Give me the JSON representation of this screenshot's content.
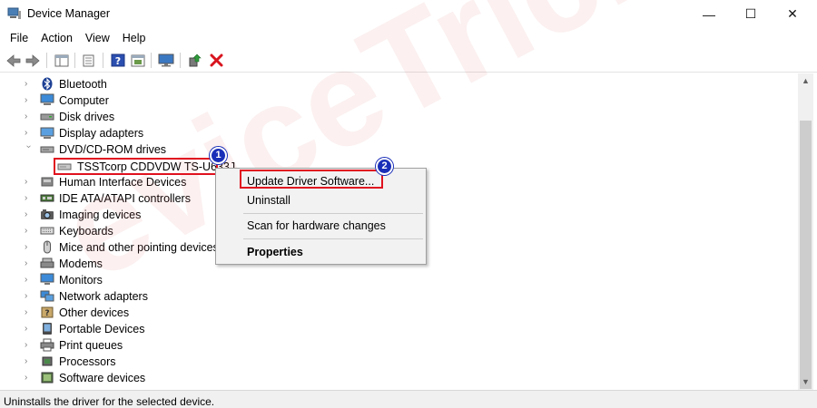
{
  "window": {
    "title": "Device Manager",
    "minimize_glyph": "—",
    "maximize_glyph": "☐",
    "close_glyph": "✕"
  },
  "menu": [
    "File",
    "Action",
    "View",
    "Help"
  ],
  "toolbar": {
    "icons": [
      "back-arrow-icon",
      "forward-arrow-icon",
      "show-hide-console-tree-icon",
      "properties-icon",
      "help-icon",
      "action-pane-icon",
      "monitor-icon",
      "update-driver-icon",
      "uninstall-x-icon"
    ],
    "uninstall_color": "#d8141e"
  },
  "tree": {
    "items": [
      {
        "label": "Bluetooth",
        "icon": "bluetooth-icon",
        "expanded": false
      },
      {
        "label": "Computer",
        "icon": "computer-icon",
        "expanded": false
      },
      {
        "label": "Disk drives",
        "icon": "disk-drive-icon",
        "expanded": false
      },
      {
        "label": "Display adapters",
        "icon": "display-adapter-icon",
        "expanded": false
      },
      {
        "label": "DVD/CD-ROM drives",
        "icon": "dvd-drive-icon",
        "expanded": true
      },
      {
        "label": "TSSTcorp CDDVDW TS-U633J",
        "icon": "dvd-drive-icon",
        "child": true
      },
      {
        "label": "Human Interface Devices",
        "icon": "hid-icon",
        "expanded": false
      },
      {
        "label": "IDE ATA/ATAPI controllers",
        "icon": "ide-controller-icon",
        "expanded": false
      },
      {
        "label": "Imaging devices",
        "icon": "camera-icon",
        "expanded": false
      },
      {
        "label": "Keyboards",
        "icon": "keyboard-icon",
        "expanded": false
      },
      {
        "label": "Mice and other pointing devices",
        "icon": "mouse-icon",
        "expanded": false
      },
      {
        "label": "Modems",
        "icon": "modem-icon",
        "expanded": false
      },
      {
        "label": "Monitors",
        "icon": "monitor-icon",
        "expanded": false
      },
      {
        "label": "Network adapters",
        "icon": "network-adapter-icon",
        "expanded": false
      },
      {
        "label": "Other devices",
        "icon": "other-devices-icon",
        "expanded": false
      },
      {
        "label": "Portable Devices",
        "icon": "portable-device-icon",
        "expanded": false
      },
      {
        "label": "Print queues",
        "icon": "printer-icon",
        "expanded": false
      },
      {
        "label": "Processors",
        "icon": "processor-icon",
        "expanded": false
      },
      {
        "label": "Software devices",
        "icon": "software-device-icon",
        "expanded": false
      }
    ]
  },
  "context_menu": {
    "items": [
      {
        "label": "Update Driver Software...",
        "bold": false
      },
      {
        "label": "Uninstall",
        "bold": false
      },
      {
        "label": "Scan for hardware changes",
        "bold": false
      },
      {
        "label": "Properties",
        "bold": true
      }
    ]
  },
  "annotations": {
    "badge1": "1",
    "badge2": "2",
    "highlight_color": "#e0121f",
    "badge_color": "#1a2fb8"
  },
  "watermark": "eviceTricks",
  "status": {
    "text": "Uninstalls the driver for the selected device."
  }
}
